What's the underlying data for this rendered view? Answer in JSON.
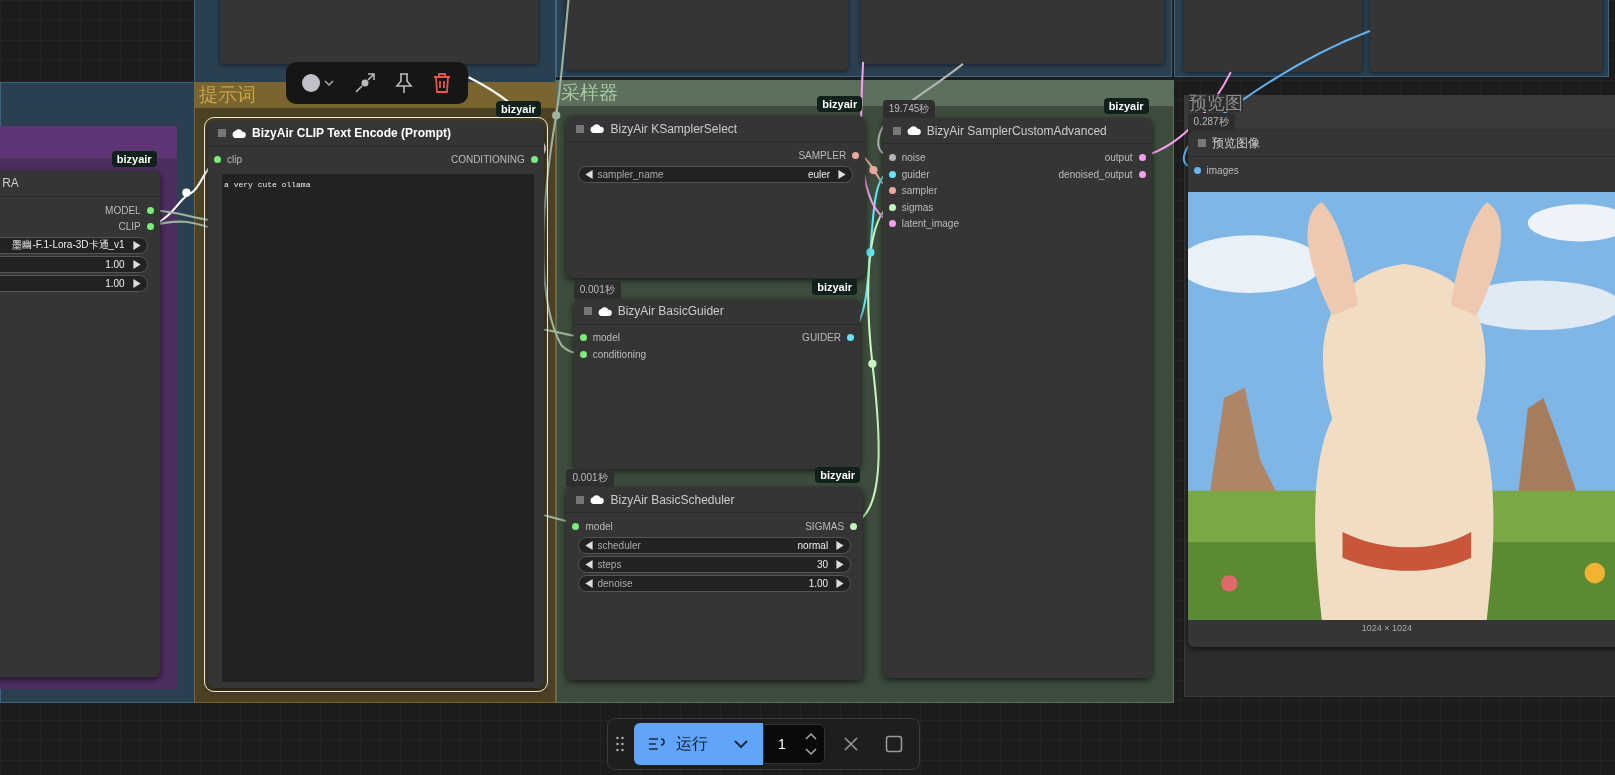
{
  "groups": [
    {
      "title": "提示词"
    },
    {
      "title": "采样器"
    },
    {
      "title": "预览图"
    }
  ],
  "nodes": [
    {
      "title": "RA",
      "badge": "bizyair",
      "outputs": [
        {
          "label": "MODEL",
          "color": "#7bed7b"
        },
        {
          "label": "CLIP",
          "color": "#7bed7b"
        }
      ],
      "widgets": [
        {
          "value": "墨幽-F.1-Lora-3D卡通_v1"
        },
        {
          "value": "1.00"
        },
        {
          "value": "1.00"
        }
      ]
    },
    {
      "title": "BizyAir CLIP Text Encode (Prompt)",
      "badge": "bizyair",
      "selected": true,
      "inputs": [
        {
          "label": "clip",
          "color": "#7bed7b"
        }
      ],
      "outputs": [
        {
          "label": "CONDITIONING",
          "color": "#7bed7b"
        }
      ],
      "text": "a very cute ollama"
    },
    {
      "title": "BizyAir KSamplerSelect",
      "badge": "bizyair",
      "selected": false,
      "outputs": [
        {
          "label": "SAMPLER",
          "color": "#eca89e"
        }
      ],
      "widgets": [
        {
          "name": "sampler_name",
          "value": "euler"
        }
      ]
    },
    {
      "title": "BizyAir BasicGuider",
      "time": "0.001秒",
      "badge": "bizyair",
      "selected": false,
      "inputs": [
        {
          "label": "model",
          "color": "#7bed7b"
        },
        {
          "label": "conditioning",
          "color": "#7bed7b"
        }
      ],
      "outputs": [
        {
          "label": "GUIDER",
          "color": "#66e6f5"
        }
      ]
    },
    {
      "title": "BizyAir BasicScheduler",
      "time": "0.001秒",
      "badge": "bizyair",
      "selected": false,
      "inputs": [
        {
          "label": "model",
          "color": "#7bed7b"
        }
      ],
      "outputs": [
        {
          "label": "SIGMAS",
          "color": "#c6f5bf"
        }
      ],
      "widgets": [
        {
          "name": "scheduler",
          "value": "normal"
        },
        {
          "name": "steps",
          "value": "30"
        },
        {
          "name": "denoise",
          "value": "1.00"
        }
      ]
    },
    {
      "title": "BizyAir SamplerCustomAdvanced",
      "time": "19.745秒",
      "badge": "bizyair",
      "selected": false,
      "inputs": [
        {
          "label": "noise",
          "color": "#b4b4b4"
        },
        {
          "label": "guider",
          "color": "#66e6f5"
        },
        {
          "label": "sampler",
          "color": "#eca89e"
        },
        {
          "label": "sigmas",
          "color": "#c6f5bf"
        },
        {
          "label": "latent_image",
          "color": "#f59ef0"
        }
      ],
      "outputs": [
        {
          "label": "output",
          "color": "#f59ef0"
        },
        {
          "label": "denoised_output",
          "color": "#f59ef0"
        }
      ]
    },
    {
      "title": "预览图像",
      "time": "0.287秒",
      "selected": false,
      "inputs": [
        {
          "label": "images",
          "color": "#64b5f6"
        }
      ],
      "image": {
        "kind": "picture",
        "size": "1024 × 1024"
      }
    }
  ],
  "run_bar": {
    "run_label": "运行",
    "batch_count": "1"
  }
}
